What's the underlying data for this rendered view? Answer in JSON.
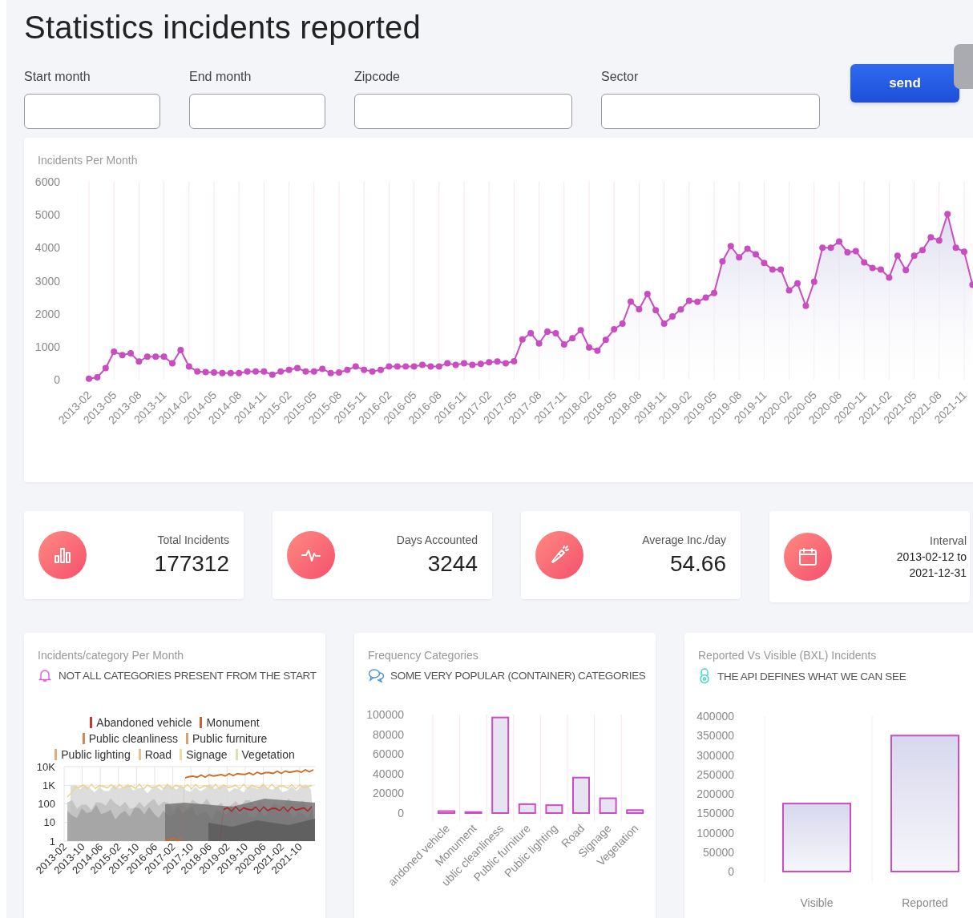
{
  "title": "Statistics incidents reported",
  "filters": [
    {
      "label": "Start month"
    },
    {
      "label": "End month"
    },
    {
      "label": "Zipcode"
    },
    {
      "label": "Sector"
    }
  ],
  "send_button": "send",
  "incidents_chart": {
    "title": "Incidents Per Month",
    "chart_data": {
      "type": "area",
      "grid": true,
      "ylim": [
        0,
        6000
      ],
      "yticks": [
        0,
        1000,
        2000,
        3000,
        4000,
        5000,
        6000
      ],
      "categories": [
        "2013-02",
        null,
        null,
        "2013-05",
        null,
        null,
        "2013-08",
        null,
        null,
        "2013-11",
        null,
        null,
        "2014-02",
        null,
        null,
        "2014-05",
        null,
        null,
        "2014-08",
        null,
        null,
        "2014-11",
        null,
        null,
        "2015-02",
        null,
        null,
        "2015-05",
        null,
        null,
        "2015-08",
        null,
        null,
        "2015-11",
        null,
        null,
        "2016-02",
        null,
        null,
        "2016-05",
        null,
        null,
        "2016-08",
        null,
        null,
        "2016-11",
        null,
        null,
        "2017-02",
        null,
        null,
        "2017-05",
        null,
        null,
        "2017-08",
        null,
        null,
        "2017-11",
        null,
        null,
        "2018-02",
        null,
        null,
        "2018-05",
        null,
        null,
        "2018-08",
        null,
        null,
        "2018-11",
        null,
        null,
        "2019-02",
        null,
        null,
        "2019-05",
        null,
        null,
        "2019-08",
        null,
        null,
        "2019-11",
        null,
        null,
        "2020-02",
        null,
        null,
        "2020-05",
        null,
        null,
        "2020-08",
        null,
        null,
        "2020-11",
        null,
        null,
        "2021-02",
        null,
        null,
        "2021-05",
        null,
        null,
        "2021-08",
        null,
        null,
        "2021-11",
        null
      ],
      "series": [
        {
          "color": "#c94cc0",
          "values": [
            30,
            70,
            350,
            850,
            750,
            800,
            550,
            700,
            700,
            700,
            500,
            900,
            400,
            250,
            230,
            220,
            200,
            200,
            200,
            250,
            250,
            250,
            150,
            250,
            300,
            350,
            250,
            250,
            330,
            200,
            220,
            300,
            400,
            300,
            250,
            300,
            400,
            400,
            400,
            400,
            450,
            400,
            400,
            500,
            450,
            500,
            450,
            480,
            530,
            550,
            500,
            560,
            1220,
            1410,
            1100,
            1460,
            1410,
            1070,
            1260,
            1500,
            980,
            880,
            1210,
            1530,
            1700,
            2370,
            2140,
            2600,
            2110,
            1700,
            1920,
            2130,
            2390,
            2360,
            2490,
            2630,
            3590,
            4050,
            3710,
            3970,
            3800,
            3540,
            3340,
            3340,
            2710,
            2920,
            2240,
            2970,
            4000,
            4000,
            4190,
            3860,
            3900,
            3560,
            3390,
            3340,
            3100,
            3760,
            3320,
            3760,
            3930,
            4320,
            4220,
            5020,
            4000,
            3880,
            2880
          ]
        }
      ]
    }
  },
  "stats": [
    {
      "kind": "bars",
      "label": "Total Incidents",
      "value": "177312"
    },
    {
      "kind": "pulse",
      "label": "Days Accounted",
      "value": "3244"
    },
    {
      "kind": "flashlight",
      "label": "Average Inc./day",
      "value": "54.66"
    },
    {
      "kind": "calendar",
      "label": "Interval",
      "value_lines": [
        "2013-02-12 to",
        "2021-12-31"
      ]
    }
  ],
  "category_chart": {
    "title": "Incidents/category Per Month",
    "note": "NOT ALL CATEGORIES PRESENT FROM THE START",
    "legend": [
      {
        "name": "Abandoned vehicle",
        "color": "#c0392b"
      },
      {
        "name": "Monument",
        "color": "#c8652a"
      },
      {
        "name": "Public cleanliness",
        "color": "#cf8a52"
      },
      {
        "name": "Public furniture",
        "color": "#d9a06a"
      },
      {
        "name": "Public lighting",
        "color": "#d8b27c"
      },
      {
        "name": "Road",
        "color": "#e2c58c"
      },
      {
        "name": "Signage",
        "color": "#eadb9e"
      },
      {
        "name": "Vegetation",
        "color": "#dfe2a8"
      }
    ],
    "yticks": [
      "10K",
      "1K",
      "100",
      "10",
      "1"
    ],
    "xticks": [
      "2013-02",
      "2013-10",
      "2014-06",
      "2015-02",
      "2015-10",
      "2016-06",
      "2017-02",
      "2017-10",
      "2018-06",
      "2019-02",
      "2019-10",
      "2020-06",
      "2021-02",
      "2021-10"
    ]
  },
  "frequency_chart": {
    "title": "Frequency Categories",
    "note": "SOME VERY POPULAR (CONTAINER) CATEGORIES",
    "chart_data": {
      "type": "bar",
      "categories": [
        "andoned vehicle",
        "Monument",
        "ublic cleanliness",
        "Public furniture",
        "Public lighting",
        "Road",
        "Signage",
        "Vegetation"
      ],
      "values": [
        2000,
        1000,
        97000,
        9000,
        8000,
        36000,
        15000,
        3000
      ],
      "ylim": [
        0,
        100000
      ],
      "yticks": [
        0,
        20000,
        40000,
        60000,
        80000,
        100000
      ]
    }
  },
  "visible_chart": {
    "title": "Reported Vs Visible (BXL) Incidents",
    "note": "THE API DEFINES WHAT WE CAN SEE",
    "chart_data": {
      "type": "bar",
      "categories": [
        "Visible",
        "Reported"
      ],
      "values": [
        175000,
        350000
      ],
      "ylim": [
        0,
        400000
      ],
      "yticks": [
        0,
        50000,
        100000,
        150000,
        200000,
        250000,
        300000,
        350000,
        400000
      ]
    }
  }
}
